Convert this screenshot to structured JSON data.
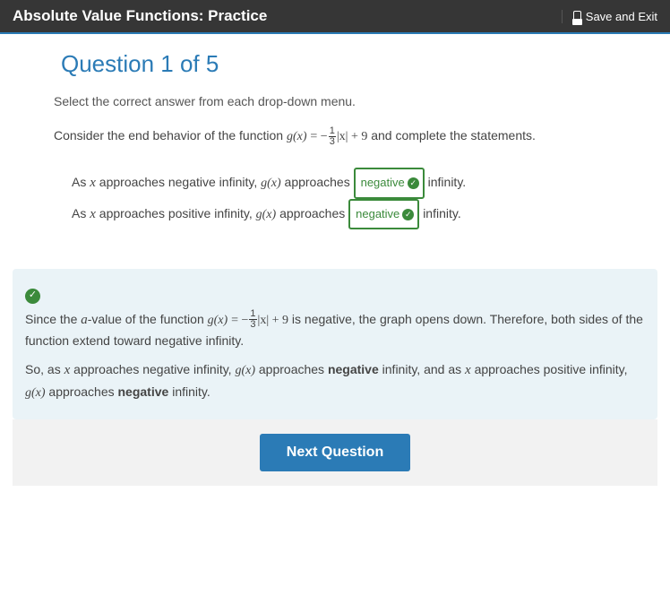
{
  "header": {
    "title": "Absolute Value Functions: Practice",
    "save_exit_label": "Save and Exit"
  },
  "question": {
    "number_label": "Question 1 of 5",
    "instruction": "Select the correct answer from each drop-down menu.",
    "prompt_pre": "Consider the end behavior of the function ",
    "func_gx": "g(x)",
    "eq_sign": " = ",
    "neg": "−",
    "frac_num": "1",
    "frac_den": "3",
    "abs_x": "|x|",
    "plus_nine": " + 9",
    "prompt_post": " and complete the statements.",
    "line1_pre": "As ",
    "var_x": "x",
    "line1_mid": " approaches negative infinity, ",
    "approaches_word": " approaches ",
    "dropdown1_value": "negative",
    "line1_end": " infinity.",
    "line2_mid": " approaches positive infinity, ",
    "dropdown2_value": "negative",
    "line2_end": " infinity."
  },
  "feedback": {
    "since_pre": "Since the ",
    "var_a": "a",
    "since_mid": "-value of the function ",
    "is_negative": " is negative, the graph opens down. Therefore, both sides of the function extend toward negative infinity.",
    "so_as_pre": "So, as ",
    "so_mid1": " approaches negative infinity, ",
    "approaches_word": " approaches ",
    "negative_bold": "negative",
    "so_mid2": " infinity, and as ",
    "so_mid3": " approaches positive infinity, ",
    "infinity_end": " infinity."
  },
  "next_button_label": "Next Question"
}
